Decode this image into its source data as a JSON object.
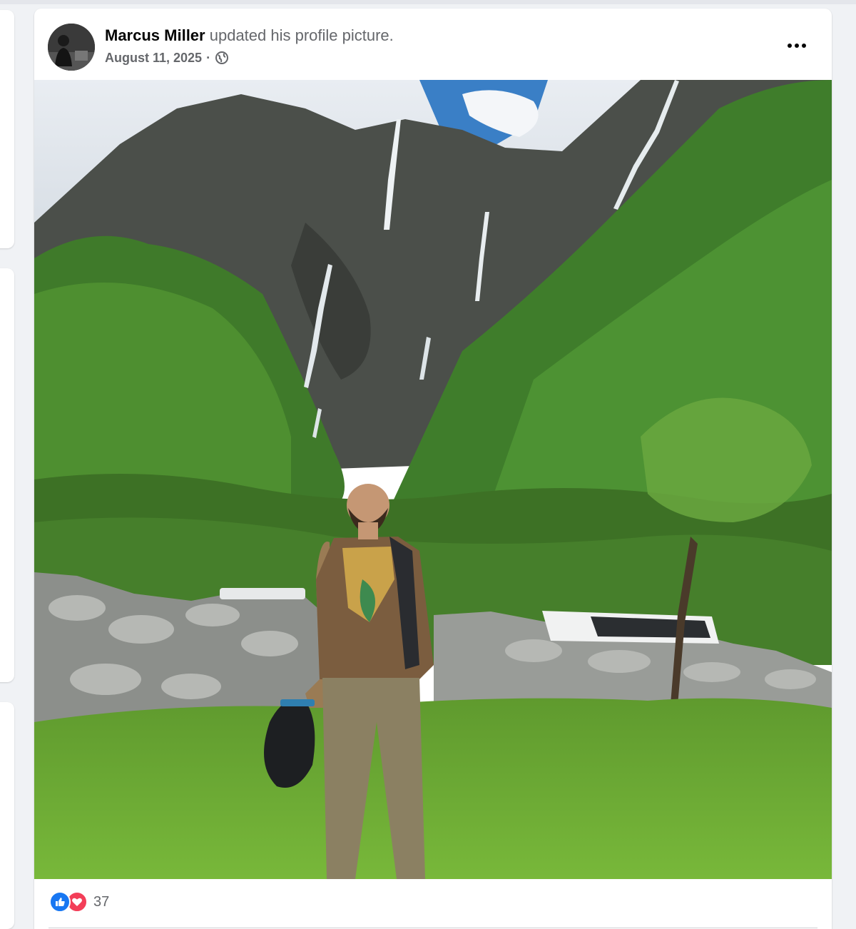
{
  "post": {
    "author": "Marcus Miller",
    "action_text": "updated his profile picture.",
    "date": "August 11, 2025",
    "separator": "·",
    "privacy_icon": "globe-icon",
    "more_icon": "more-options-icon",
    "photo_description_icon": "profile-photo",
    "reactions": {
      "icons": [
        "like-icon",
        "love-icon"
      ],
      "count": "37"
    }
  },
  "colors": {
    "like": "#1877f2",
    "love": "#f33e58",
    "text_primary": "#050505",
    "text_secondary": "#65676b",
    "background": "#f0f2f5"
  }
}
